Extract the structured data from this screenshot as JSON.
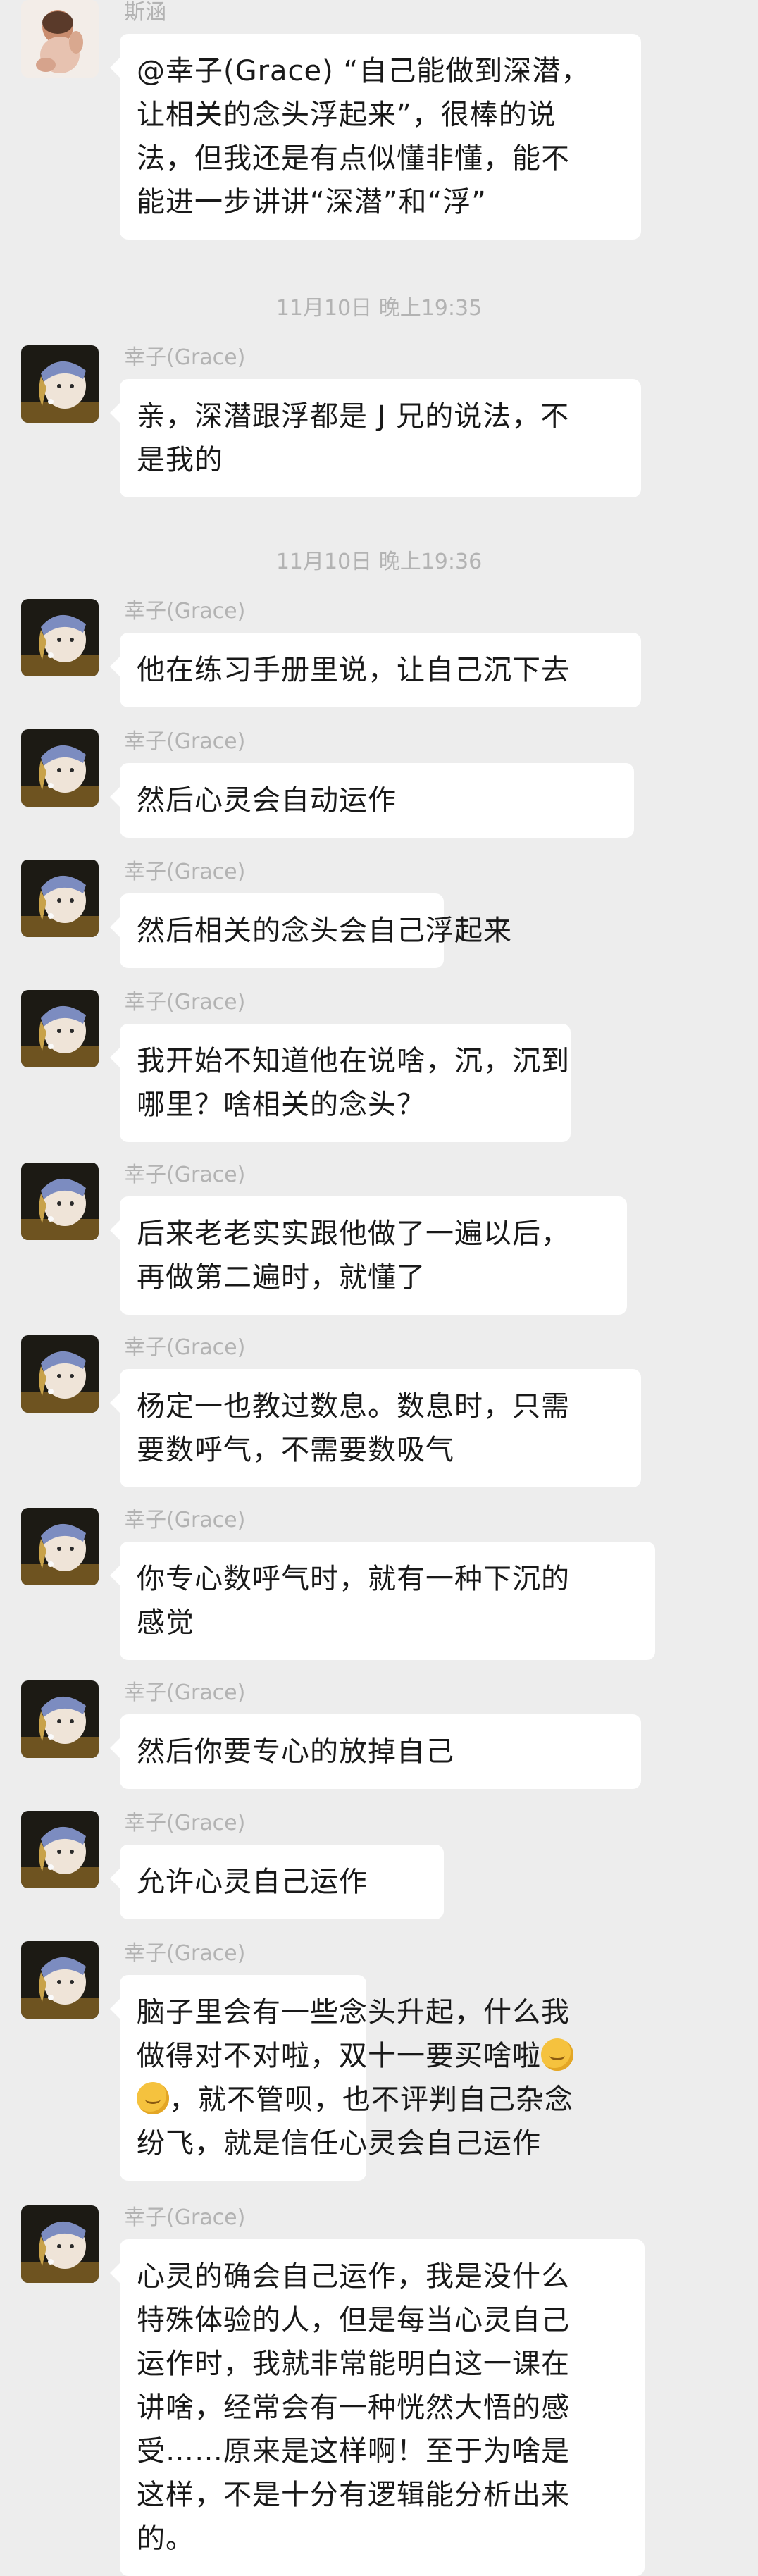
{
  "messages": [
    {
      "sender": "斯涵",
      "avatar": "baby-photo-avatar",
      "lines": [
        "@幸子(Grace) “自己能做到深潜，",
        "让相关的念头浮起来”，很棒的说",
        "法，但我还是有点似懂非懂，能不",
        "能进一步讲讲“深潜”和“浮”"
      ]
    },
    {
      "timestamp": "11月10日 晚上19:35"
    },
    {
      "sender": "幸子(Grace)",
      "avatar": "pearl-earring-girl-avatar",
      "lines": [
        "亲，深潜跟浮都是 J 兄的说法，不",
        "是我的"
      ]
    },
    {
      "timestamp": "11月10日 晚上19:36"
    },
    {
      "sender": "幸子(Grace)",
      "avatar": "pearl-earring-girl-avatar",
      "lines": [
        "他在练习手册里说，让自己沉下去"
      ]
    },
    {
      "sender": "幸子(Grace)",
      "avatar": "pearl-earring-girl-avatar",
      "lines": [
        "然后心灵会自动运作"
      ]
    },
    {
      "sender": "幸子(Grace)",
      "avatar": "pearl-earring-girl-avatar",
      "lines": [
        "然后相关的念头会自己浮起来"
      ]
    },
    {
      "sender": "幸子(Grace)",
      "avatar": "pearl-earring-girl-avatar",
      "lines": [
        "我开始不知道他在说啥，沉，沉到",
        "哪里？啥相关的念头？"
      ]
    },
    {
      "sender": "幸子(Grace)",
      "avatar": "pearl-earring-girl-avatar",
      "lines": [
        "后来老老实实跟他做了一遍以后，",
        "再做第二遍时，就懂了"
      ]
    },
    {
      "sender": "幸子(Grace)",
      "avatar": "pearl-earring-girl-avatar",
      "lines": [
        "杨定一也教过数息。数息时，只需",
        "要数呼气，不需要数吸气"
      ]
    },
    {
      "sender": "幸子(Grace)",
      "avatar": "pearl-earring-girl-avatar",
      "lines": [
        "你专心数呼气时，就有一种下沉的",
        "感觉"
      ]
    },
    {
      "sender": "幸子(Grace)",
      "avatar": "pearl-earring-girl-avatar",
      "lines": [
        "然后你要专心的放掉自己"
      ]
    },
    {
      "sender": "幸子(Grace)",
      "avatar": "pearl-earring-girl-avatar",
      "lines": [
        "允许心灵自己运作"
      ]
    },
    {
      "sender": "幸子(Grace)",
      "avatar": "pearl-earring-girl-avatar",
      "lines": [
        "脑子里会有一些念头升起，什么我",
        "做得对不对啦，双十一要买啥啦",
        "，就不管呗，也不评判自己杂念",
        "纷飞，就是信任心灵会自己运作"
      ],
      "emoji": "thinking-face-emoji"
    },
    {
      "sender": "幸子(Grace)",
      "avatar": "pearl-earring-girl-avatar",
      "lines": [
        "心灵的确会自己运作，我是没什么",
        "特殊体验的人，但是每当心灵自己",
        "运作时，我就非常能明白这一课在",
        "讲啥，经常会有一种恍然大悟的感",
        "受……原来是这样啊！至于为啥是",
        "这样，不是十分有逻辑能分析出来",
        "的。"
      ]
    }
  ]
}
